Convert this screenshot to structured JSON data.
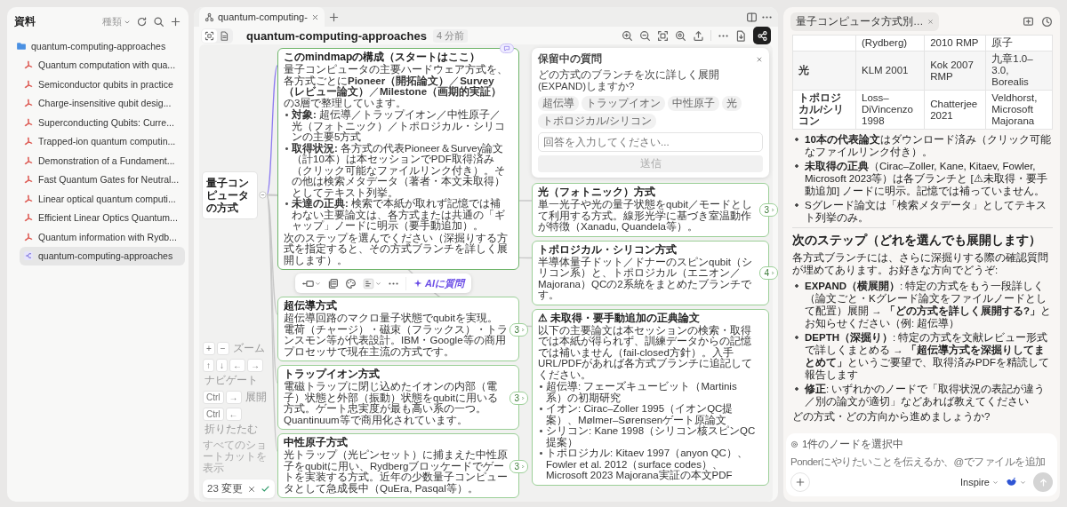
{
  "sidebar": {
    "title": "資料",
    "filter": "種類",
    "tree": [
      {
        "kind": "folder",
        "label": "quantum-computing-approaches",
        "selected": false,
        "children": [
          {
            "kind": "pdf",
            "label": "Quantum computation with qua...",
            "selected": false
          },
          {
            "kind": "pdf",
            "label": "Semiconductor qubits in practice",
            "selected": false
          },
          {
            "kind": "pdf",
            "label": "Charge-insensitive qubit desig...",
            "selected": false
          },
          {
            "kind": "pdf",
            "label": "Superconducting Qubits: Curre...",
            "selected": false
          },
          {
            "kind": "pdf",
            "label": "Trapped-ion quantum computin...",
            "selected": false
          },
          {
            "kind": "pdf",
            "label": "Demonstration of a Fundament...",
            "selected": false
          },
          {
            "kind": "pdf",
            "label": "Fast Quantum Gates for Neutral...",
            "selected": false
          },
          {
            "kind": "pdf",
            "label": "Linear optical quantum computi...",
            "selected": false
          },
          {
            "kind": "pdf",
            "label": "Efficient Linear Optics Quantum...",
            "selected": false
          },
          {
            "kind": "pdf",
            "label": "Quantum information with Rydb...",
            "selected": false
          },
          {
            "kind": "mindmap",
            "label": "quantum-computing-approaches",
            "selected": true
          }
        ]
      }
    ]
  },
  "editor": {
    "tabs": [
      {
        "label": "quantum-computing-",
        "selected": true
      }
    ],
    "view_modes": [
      {
        "kind": "focus",
        "selected": true
      },
      {
        "kind": "document",
        "selected": false
      }
    ],
    "title": "quantum-computing-approaches",
    "edited": "4 分前",
    "mindmap": {
      "root": {
        "title": "量子コンピュータの方式",
        "expanded": true
      },
      "nodes": [
        {
          "title": "このmindmapの構成（スタートはここ）",
          "selected": true,
          "comments": true,
          "body": [
            {
              "kind": "para",
              "text": "量子コンピュータの主要ハードウェア方式を、各方式ごとに**Pioneer（開拓論文）**／**Survey（レビュー論文）**／**Milestone（画期的実証）**の3層で整理しています。"
            },
            {
              "kind": "list",
              "items": [
                "**対象:** 超伝導／トラップイオン／中性原子／光（フォトニック）／トポロジカル・シリコンの主要5方式",
                "**取得状況:** 各方式の代表Pioneer＆Survey論文（計10本）は本セッションでPDF取得済み（クリック可能なファイルリンク付き）。その他は検索メタデータ（著者・本文未取得）としてテキスト列挙。",
                "**未達の正典:** 検索で本紙が取れず記憶では補わない主要論文は、各方式または共通の「ギャップ」ノードに明示（要手動追加）。"
              ]
            },
            {
              "kind": "para",
              "text": "次のステップを選んでください（深掘りする方式を指定すると、その方式ブランチを詳しく展開します）。"
            }
          ]
        },
        {
          "title": "超伝導方式",
          "selected": false,
          "comments": false,
          "children": "3",
          "body": [
            {
              "kind": "para",
              "text": "超伝導回路のマクロ量子状態でqubitを実現。電荷（チャージ）・磁束（フラックス）・トランスモン等が代表設計。IBM・Google等の商用プロセッサで現在主流の方式です。"
            }
          ]
        },
        {
          "title": "トラップイオン方式",
          "selected": false,
          "comments": false,
          "children": "3",
          "body": [
            {
              "kind": "para",
              "text": "電磁トラップに閉じ込めたイオンの内部（電子）状態と外部（振動）状態をqubitに用いる方式。ゲート忠実度が最も高い系の一つ。Quantinuum等で商用化されています。"
            }
          ]
        },
        {
          "title": "中性原子方式",
          "selected": false,
          "comments": false,
          "children": "3",
          "body": [
            {
              "kind": "para",
              "text": "光トラップ（光ピンセット）に捕まえた中性原子をqubitに用い、Rydbergブロッケードでゲートを実装する方式。近年の少数量子コンピュータとして急成長中（QuEra, Pasqal等）。"
            }
          ]
        },
        {
          "title": "光（フォトニック）方式",
          "selected": false,
          "comments": false,
          "children": "3",
          "body": [
            {
              "kind": "para",
              "text": "単一光子や光の量子状態をqubit／モードとして利用する方式。線形光学に基づき室温動作が特徴（Xanadu, Quandela等）。"
            }
          ]
        },
        {
          "title": "トポロジカル・シリコン方式",
          "selected": false,
          "comments": false,
          "children": "4",
          "body": [
            {
              "kind": "para",
              "text": "半導体量子ドット／ドナーのスピンqubit（シリコン系）と、トポロジカル（エニオン／Majorana）QCの2系統をまとめたブランチです。"
            }
          ]
        },
        {
          "title": "⚠ 未取得・要手動追加の正典論文",
          "selected": false,
          "comments": false,
          "body": [
            {
              "kind": "para",
              "text": "以下の主要論文は本セッションの検索・取得では本紙が得られず、訓練データからの記憶では補いません（fail-closed方針）。入手URL/PDFがあれば各方式ブランチに追記してください。"
            },
            {
              "kind": "list",
              "items": [
                "超伝導: フェーズキュービット（Martinis系）の初期研究",
                "イオン: Cirac–Zoller 1995（イオンQC提案）、Mølmer–Sørensenゲート原論文",
                "シリコン: Kane 1998（シリコン核スピンQC提案）",
                "トポロジカル: Kitaev 1997（anyon QC）、Fowler et al. 2012（surface codes）、Microsoft 2023 Majorana実証の本文PDF"
              ]
            }
          ]
        }
      ]
    },
    "node_toolbar": {
      "ask_ai": "AIに質問"
    },
    "pending_question": {
      "title": "保留中の質問",
      "question": "どの方式のブランチを次に詳しく展開(EXPAND)しますか?",
      "options": [
        "超伝導",
        "トラップイオン",
        "中性原子",
        "光",
        "トポロジカル/シリコン"
      ],
      "placeholder": "回答を入力してください...",
      "submit": "送信",
      "submit_disabled": true
    },
    "shortcuts": [
      {
        "keys": [
          "+",
          "−"
        ],
        "label": "ズーム"
      },
      {
        "keys": [
          "↑",
          "↓",
          "←",
          "→"
        ],
        "label": "ナビゲート"
      },
      {
        "keys": [
          "Ctrl",
          "→"
        ],
        "label": "展開"
      },
      {
        "keys": [
          "Ctrl",
          "←"
        ],
        "label": "折りたたむ"
      }
    ],
    "show_all_shortcuts": "すべてのショートカットを表示",
    "changes": {
      "label": "23 変更"
    }
  },
  "chat": {
    "tab": "量子コンピュータ方式別…",
    "table": {
      "rows": [
        {
          "cells": [
            "",
            "(Rydberg)",
            "2010 RMP",
            "原子"
          ]
        },
        {
          "cells": [
            "光",
            "KLM 2001",
            "Kok 2007 RMP",
            "九章1.0–3.0, Borealis"
          ]
        },
        {
          "cells": [
            "トポロジカル/シリコン",
            "Loss–DiVincenzo 1998",
            "Chatterjee 2021",
            "Veldhorst, Microsoft Majorana"
          ]
        }
      ]
    },
    "blocks": [
      {
        "kind": "list",
        "items": [
          "**10本の代表論文**はダウンロード済み（クリック可能なファイルリンク付き）。",
          "**未取得の正典**（Cirac–Zoller, Kane, Kitaev, Fowler, Microsoft 2023等）は各ブランチと [⚠未取得・要手動追加] ノードに明示。記憶では補っていません。",
          "Sグレード論文は「検索メタデータ」としてテキスト列挙のみ。"
        ]
      },
      {
        "kind": "rule"
      },
      {
        "kind": "heading",
        "text": "次のステップ（どれを選んでも展開します）"
      },
      {
        "kind": "para",
        "text": "各方式ブランチには、さらに深掘りする際の確認質問が埋めてあります。お好きな方向でどうぞ:"
      },
      {
        "kind": "list",
        "items": [
          "**EXPAND（横展開）**: 特定の方式をもう一段詳しく（論文ごと・Kグレード論文をファイルノードとして配置）展開 → **「どの方式を詳しく展開する?」**とお知らせください（例: 超伝導）",
          "**DEPTH（深掘り）**: 特定の方式を文献レビュー形式で詳しくまとめる → **「超伝導方式を深掘りしてまとめて」**というご要望で、取得済みPDFを精読して報告します",
          "**修正**: いずれかのノードで「取得状況の表記が違う／別の論文が適切」などあれば教えてください"
        ]
      },
      {
        "kind": "para",
        "text": "どの方式・どの方向から進めましょうか?"
      }
    ],
    "composer": {
      "context": "1件のノードを選択中",
      "placeholder": "Ponderにやりたいことを伝えるか、@でファイルを追加",
      "mode": "Inspire",
      "send_disabled": true
    }
  }
}
